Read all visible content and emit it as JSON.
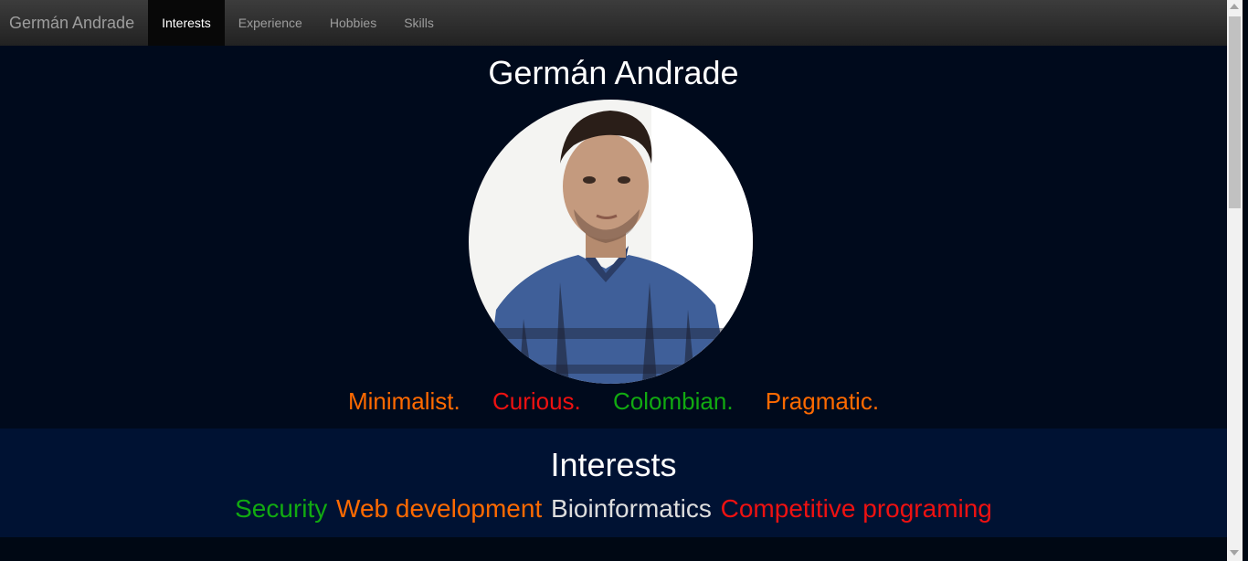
{
  "navbar": {
    "brand": "Germán Andrade",
    "items": [
      {
        "label": "Interests",
        "active": true
      },
      {
        "label": "Experience",
        "active": false
      },
      {
        "label": "Hobbies",
        "active": false
      },
      {
        "label": "Skills",
        "active": false
      }
    ]
  },
  "hero": {
    "title": "Germán Andrade",
    "avatar_icon": "profile-photo",
    "traits": [
      {
        "label": "Minimalist.",
        "color": "#ff6a00"
      },
      {
        "label": "Curious.",
        "color": "#ee1111"
      },
      {
        "label": "Colombian.",
        "color": "#11aa11"
      },
      {
        "label": "Pragmatic.",
        "color": "#ff6a00"
      }
    ]
  },
  "interests": {
    "title": "Interests",
    "items": [
      {
        "label": "Security",
        "color": "#11aa11"
      },
      {
        "label": "Web development",
        "color": "#ff6a00"
      },
      {
        "label": "Bioinformatics",
        "color": "#dddddd"
      },
      {
        "label": "Competitive programing",
        "color": "#ee1111"
      }
    ]
  }
}
